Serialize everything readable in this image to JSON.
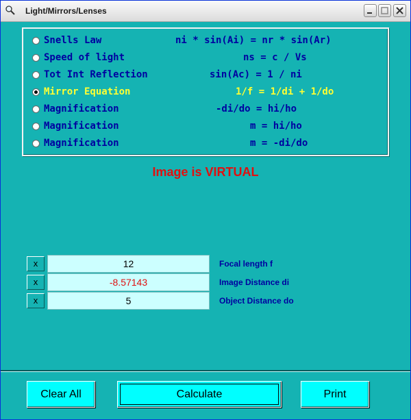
{
  "window": {
    "title": "Light/Mirrors/Lenses"
  },
  "options": [
    {
      "label": "Snells Law",
      "equation": "ni * sin(Ai) = nr * sin(Ar)",
      "selected": false
    },
    {
      "label": "Speed of light",
      "equation": "ns = c / Vs",
      "selected": false
    },
    {
      "label": "Tot Int Reflection",
      "equation": "sin(Ac) = 1 / ni",
      "selected": false
    },
    {
      "label": "Mirror Equation",
      "equation": "1/f = 1/di + 1/do",
      "selected": true
    },
    {
      "label": "Magnification",
      "equation": "-di/do = hi/ho",
      "selected": false
    },
    {
      "label": "Magnification",
      "equation": "m = hi/ho",
      "selected": false
    },
    {
      "label": "Magnification",
      "equation": "m = -di/do",
      "selected": false
    }
  ],
  "status_text": "Image is VIRTUAL",
  "fields": [
    {
      "clear_label": "x",
      "value": "12",
      "label": "Focal length  f",
      "highlight": false
    },
    {
      "clear_label": "x",
      "value": "-8.57143",
      "label": "Image Distance  di",
      "highlight": true
    },
    {
      "clear_label": "x",
      "value": "5",
      "label": "Object Distance  do",
      "highlight": false
    }
  ],
  "buttons": {
    "clear_all": "Clear All",
    "calculate": "Calculate",
    "print": "Print"
  },
  "colors": {
    "background": "#15b3b3",
    "field_bg": "#ccffff",
    "button_bg": "#00ffff",
    "label": "#0000a0",
    "selected": "#ffff33",
    "alert": "#e01010"
  }
}
